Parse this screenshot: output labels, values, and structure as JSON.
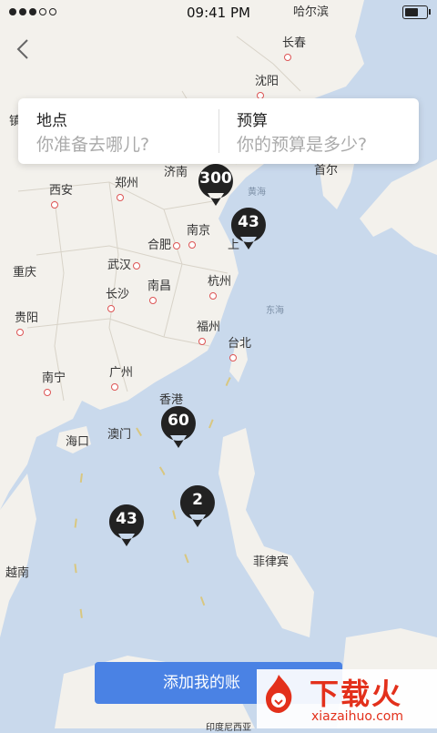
{
  "status": {
    "time": "09:41 PM",
    "battery_level": 0.7
  },
  "search": {
    "location_label": "地点",
    "location_placeholder": "你准备去哪儿?",
    "budget_label": "预算",
    "budget_placeholder": "你的预算是多少?"
  },
  "cities": {
    "haerbin": "哈尔滨",
    "changchun": "长春",
    "shenyang": "沈阳",
    "jinan": "济南",
    "xian": "西安",
    "zhengzhou": "郑州",
    "nanjing": "南京",
    "hefei": "合肥",
    "shanghai": "上",
    "wuhan": "武汉",
    "chongqing": "重庆",
    "changsha": "长沙",
    "nanchang": "南昌",
    "hangzhou": "杭州",
    "guiyang": "贵阳",
    "fuzhou": "福州",
    "taibei": "台北",
    "nanning": "南宁",
    "guangzhou": "广州",
    "xianggang": "香港",
    "aomen": "澳门",
    "haikou": "海口",
    "feilvbin": "菲律宾",
    "yuenan": "越南",
    "yindunixiya": "印度尼西亚",
    "zhen": "镇",
    "shouer": "首尔"
  },
  "seas": {
    "yellow": "黄海",
    "east": "东海"
  },
  "pins": [
    {
      "count": "300"
    },
    {
      "count": "43"
    },
    {
      "count": "60"
    },
    {
      "count": "2"
    },
    {
      "count": "43"
    }
  ],
  "add_button": "添加我的账",
  "watermark": {
    "text": "下载火",
    "url": "xiazaihuo.com"
  },
  "colors": {
    "map_water": "#c9d9ec",
    "map_land": "#f3f1ec",
    "pin": "#222222",
    "button": "#4a82e4",
    "watermark": "#e3301b"
  }
}
